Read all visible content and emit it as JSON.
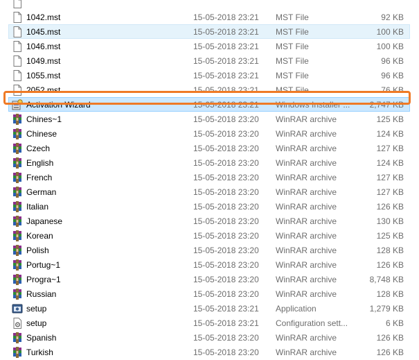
{
  "files": [
    {
      "name": "",
      "date": "",
      "type": "",
      "size": "",
      "icon": "doc-icon"
    },
    {
      "name": "1042.mst",
      "date": "15-05-2018 23:21",
      "type": "MST File",
      "size": "92 KB",
      "icon": "doc-icon"
    },
    {
      "name": "1045.mst",
      "date": "15-05-2018 23:21",
      "type": "MST File",
      "size": "100 KB",
      "icon": "doc-icon"
    },
    {
      "name": "1046.mst",
      "date": "15-05-2018 23:21",
      "type": "MST File",
      "size": "100 KB",
      "icon": "doc-icon"
    },
    {
      "name": "1049.mst",
      "date": "15-05-2018 23:21",
      "type": "MST File",
      "size": "96 KB",
      "icon": "doc-icon"
    },
    {
      "name": "1055.mst",
      "date": "15-05-2018 23:21",
      "type": "MST File",
      "size": "96 KB",
      "icon": "doc-icon"
    },
    {
      "name": "2052.mst",
      "date": "15-05-2018 23:21",
      "type": "MST File",
      "size": "76 KB",
      "icon": "doc-icon"
    },
    {
      "name": "Activation Wizard",
      "date": "15-05-2018 23:21",
      "type": "Windows Installer ...",
      "size": "2,747 KB",
      "icon": "installer-icon"
    },
    {
      "name": "Chines~1",
      "date": "15-05-2018 23:20",
      "type": "WinRAR archive",
      "size": "125 KB",
      "icon": "winrar-icon"
    },
    {
      "name": "Chinese",
      "date": "15-05-2018 23:20",
      "type": "WinRAR archive",
      "size": "124 KB",
      "icon": "winrar-icon"
    },
    {
      "name": "Czech",
      "date": "15-05-2018 23:20",
      "type": "WinRAR archive",
      "size": "127 KB",
      "icon": "winrar-icon"
    },
    {
      "name": "English",
      "date": "15-05-2018 23:20",
      "type": "WinRAR archive",
      "size": "124 KB",
      "icon": "winrar-icon"
    },
    {
      "name": "French",
      "date": "15-05-2018 23:20",
      "type": "WinRAR archive",
      "size": "127 KB",
      "icon": "winrar-icon"
    },
    {
      "name": "German",
      "date": "15-05-2018 23:20",
      "type": "WinRAR archive",
      "size": "127 KB",
      "icon": "winrar-icon"
    },
    {
      "name": "Italian",
      "date": "15-05-2018 23:20",
      "type": "WinRAR archive",
      "size": "126 KB",
      "icon": "winrar-icon"
    },
    {
      "name": "Japanese",
      "date": "15-05-2018 23:20",
      "type": "WinRAR archive",
      "size": "130 KB",
      "icon": "winrar-icon"
    },
    {
      "name": "Korean",
      "date": "15-05-2018 23:20",
      "type": "WinRAR archive",
      "size": "125 KB",
      "icon": "winrar-icon"
    },
    {
      "name": "Polish",
      "date": "15-05-2018 23:20",
      "type": "WinRAR archive",
      "size": "128 KB",
      "icon": "winrar-icon"
    },
    {
      "name": "Portug~1",
      "date": "15-05-2018 23:20",
      "type": "WinRAR archive",
      "size": "126 KB",
      "icon": "winrar-icon"
    },
    {
      "name": "Progra~1",
      "date": "15-05-2018 23:20",
      "type": "WinRAR archive",
      "size": "8,748 KB",
      "icon": "winrar-icon"
    },
    {
      "name": "Russian",
      "date": "15-05-2018 23:20",
      "type": "WinRAR archive",
      "size": "128 KB",
      "icon": "winrar-icon"
    },
    {
      "name": "setup",
      "date": "15-05-2018 23:21",
      "type": "Application",
      "size": "1,279 KB",
      "icon": "app-icon"
    },
    {
      "name": "setup",
      "date": "15-05-2018 23:21",
      "type": "Configuration sett...",
      "size": "6 KB",
      "icon": "config-icon"
    },
    {
      "name": "Spanish",
      "date": "15-05-2018 23:20",
      "type": "WinRAR archive",
      "size": "126 KB",
      "icon": "winrar-icon"
    },
    {
      "name": "Turkish",
      "date": "15-05-2018 23:20",
      "type": "WinRAR archive",
      "size": "126 KB",
      "icon": "winrar-icon"
    }
  ],
  "selected_light_index": 2,
  "selected_index": 7,
  "colors": {
    "highlight_border": "#ef7a26",
    "selection": "#cce8ff",
    "hover": "#e5f3fb"
  }
}
